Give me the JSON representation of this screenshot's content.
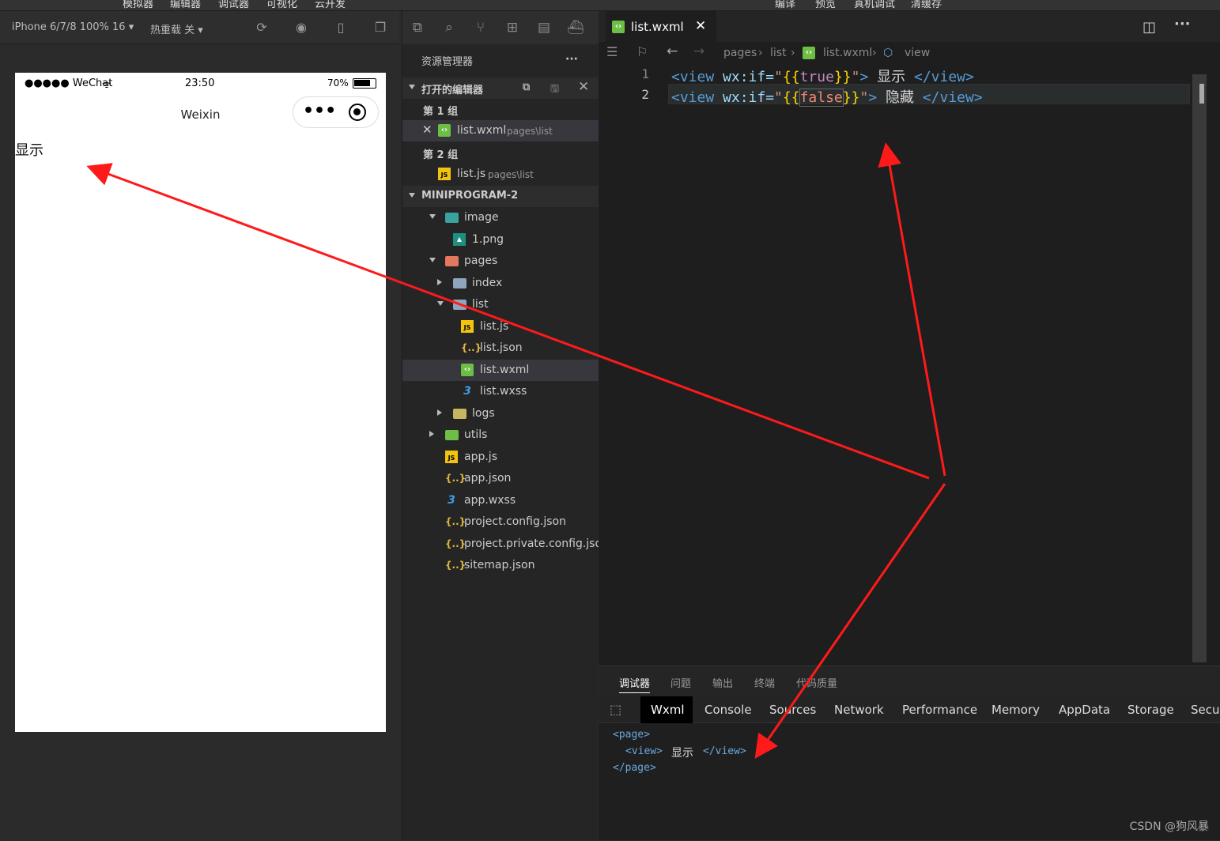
{
  "menu": [
    "模拟器",
    "编辑器",
    "调试器",
    "可视化",
    "云开发",
    "编译",
    "预览",
    "真机调试",
    "清缓存"
  ],
  "simulator": {
    "device_label": "iPhone 6/7/8 100% 16 ▾",
    "hot_reload_label": "热重载 关 ▾",
    "status": {
      "signal": "●●●●● WeChat",
      "time": "23:50",
      "battery": "70%"
    },
    "nav_title": "Weixin",
    "capsule_dots": "•••",
    "page_text": "显示"
  },
  "explorer": {
    "title": "资源管理器",
    "more": "···",
    "open_editors": "打开的编辑器",
    "group1": "第 1 组",
    "group1_file": "list.wxml",
    "group1_path": "pages\\list",
    "group2": "第 2 组",
    "group2_file": "list.js",
    "group2_path": "pages\\list",
    "project": "MINIPROGRAM-2",
    "tree": [
      {
        "label": "image",
        "kind": "folder-open",
        "depth": 1,
        "color": "#3aa3a0"
      },
      {
        "label": "1.png",
        "kind": "png",
        "depth": 2
      },
      {
        "label": "pages",
        "kind": "folder-open",
        "depth": 1,
        "color": "#e4785f"
      },
      {
        "label": "index",
        "kind": "folder",
        "depth": 2,
        "color": "#8fa5be"
      },
      {
        "label": "list",
        "kind": "folder-open",
        "depth": 2,
        "color": "#8fa5be"
      },
      {
        "label": "list.js",
        "kind": "js",
        "depth": 3
      },
      {
        "label": "list.json",
        "kind": "json",
        "depth": 3
      },
      {
        "label": "list.wxml",
        "kind": "wxml",
        "depth": 3,
        "selected": true
      },
      {
        "label": "list.wxss",
        "kind": "wxss",
        "depth": 3
      },
      {
        "label": "logs",
        "kind": "folder",
        "depth": 2,
        "color": "#c8b560"
      },
      {
        "label": "utils",
        "kind": "folder",
        "depth": 1,
        "color": "#6cbe45"
      },
      {
        "label": "app.js",
        "kind": "js",
        "depth": 1
      },
      {
        "label": "app.json",
        "kind": "json",
        "depth": 1
      },
      {
        "label": "app.wxss",
        "kind": "wxss",
        "depth": 1
      },
      {
        "label": "project.config.json",
        "kind": "json",
        "depth": 1
      },
      {
        "label": "project.private.config.json",
        "kind": "json",
        "depth": 1
      },
      {
        "label": "sitemap.json",
        "kind": "json",
        "depth": 1
      }
    ]
  },
  "editor": {
    "tab_label": "list.wxml",
    "breadcrumb": [
      "pages",
      "list",
      "list.wxml",
      "view"
    ],
    "lines": [
      {
        "num": "1",
        "open": "<view",
        "attr": " wx:if=",
        "q1": "\"",
        "b1": "{{",
        "val": "true",
        "b2": "}}",
        "q2": "\"",
        "close1": ">",
        "text": " 显示 ",
        "close2": "</view>"
      },
      {
        "num": "2",
        "open": "<view",
        "attr": " wx:if=",
        "q1": "\"",
        "b1": "{{",
        "val": "false",
        "b2": "}}",
        "q2": "\"",
        "close1": ">",
        "text": " 隐藏 ",
        "close2": "</view>"
      }
    ]
  },
  "panel": {
    "tabs": [
      "调试器",
      "问题",
      "输出",
      "终端",
      "代码质量"
    ],
    "devtools_tabs": [
      "Wxml",
      "Console",
      "Sources",
      "Network",
      "Performance",
      "Memory",
      "AppData",
      "Storage",
      "Secur"
    ],
    "dom": [
      "<page>",
      "<view>",
      "显示",
      "</view>",
      "</page>"
    ]
  },
  "watermark": "CSDN @狗风暴",
  "colors": {
    "arrow": "#ff1a1a",
    "accent": "#6cbe45"
  }
}
